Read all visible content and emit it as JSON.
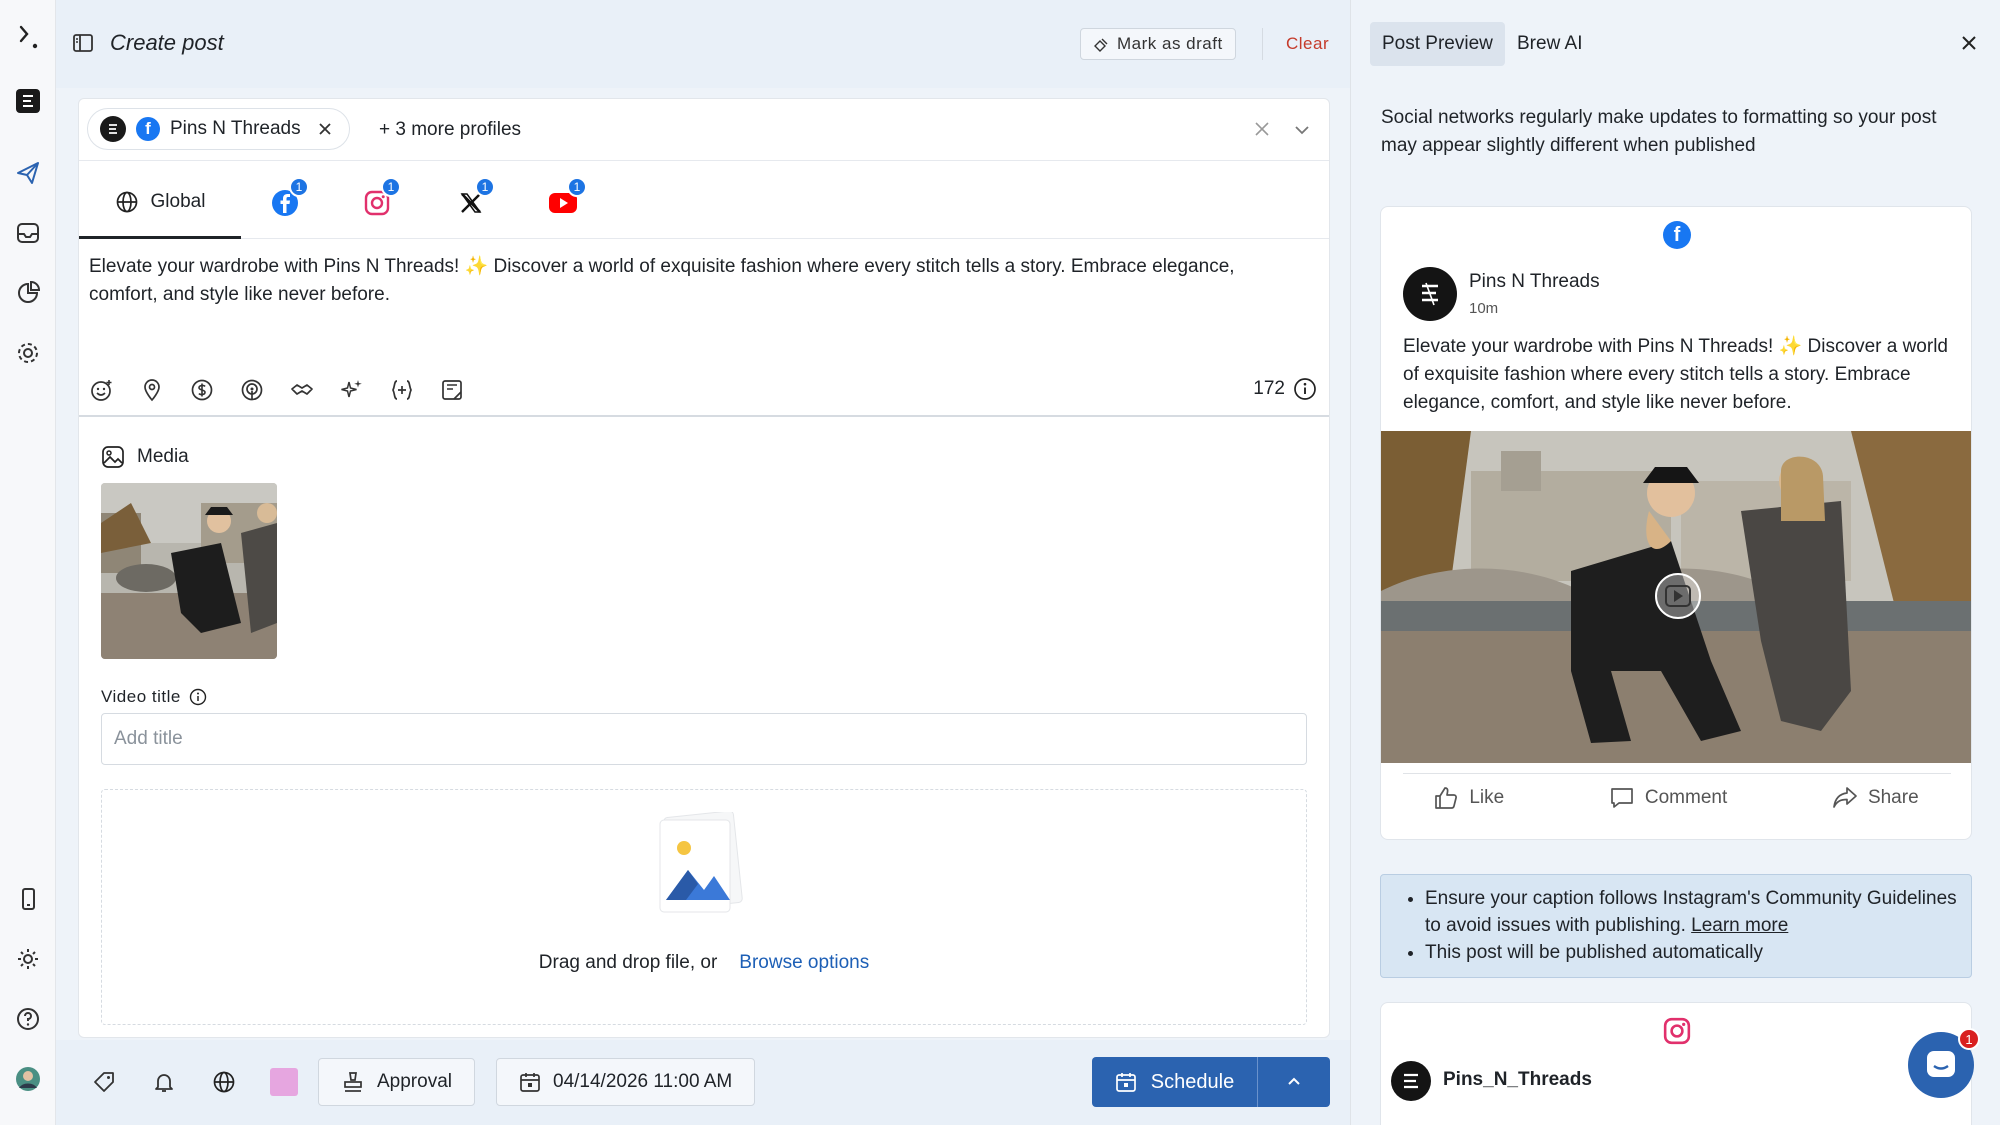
{
  "rail": {
    "icons": [
      "app-logo-icon",
      "brand-icon",
      "publish-icon",
      "inbox-icon",
      "analytics-icon",
      "settings-icon",
      "mobile-icon",
      "theme-icon",
      "help-icon",
      "user-avatar"
    ]
  },
  "composer": {
    "title": "Create post",
    "mark_draft_label": "Mark as draft",
    "clear_label": "Clear",
    "profile_chip": "Pins N Threads",
    "more_profiles": "+ 3 more profiles",
    "tabs": {
      "global": "Global",
      "networks": [
        {
          "name": "facebook",
          "badge": "1"
        },
        {
          "name": "instagram",
          "badge": "1"
        },
        {
          "name": "x",
          "badge": "1"
        },
        {
          "name": "youtube",
          "badge": "1"
        }
      ]
    },
    "post_text_a": "Elevate your wardrobe with Pins N Threads! ",
    "sparkle": "✨",
    "post_text_b": " Discover a world of exquisite fashion where every stitch tells a story. Embrace elegance, comfort, and style like never before.",
    "char_count": "172",
    "media_label": "Media",
    "video_title_label": "Video title",
    "video_title_placeholder": "Add title",
    "drop_text": "Drag and drop file, or",
    "browse_label": "Browse options"
  },
  "footer": {
    "approval_label": "Approval",
    "datetime": "04/14/2026 11:00 AM",
    "schedule_label": "Schedule",
    "label_color": "#e6a6e0"
  },
  "preview": {
    "tab_active": "Post Preview",
    "tab_other": "Brew AI",
    "note": "Social networks regularly make updates to formatting so your post may appear slightly different when published",
    "fb": {
      "name": "Pins N Threads",
      "time": "10m",
      "text_a": "Elevate your wardrobe with Pins N Threads! ",
      "sparkle": "✨",
      "text_b": " Discover a world of exquisite fashion where every stitch tells a story. Embrace elegance, comfort, and style like never before.",
      "like": "Like",
      "comment": "Comment",
      "share": "Share"
    },
    "guidelines": {
      "item1": "Ensure your caption follows Instagram's Community Guidelines to avoid issues with publishing.",
      "learn_more": "Learn more",
      "item2": "This post will be published automatically"
    },
    "ig": {
      "name": "Pins_N_Threads"
    }
  },
  "chat": {
    "badge": "1"
  },
  "colors": {
    "accent": "#2b63b0",
    "danger": "#c53b2b",
    "facebook": "#1877f2",
    "badge": "#1d74e3"
  }
}
